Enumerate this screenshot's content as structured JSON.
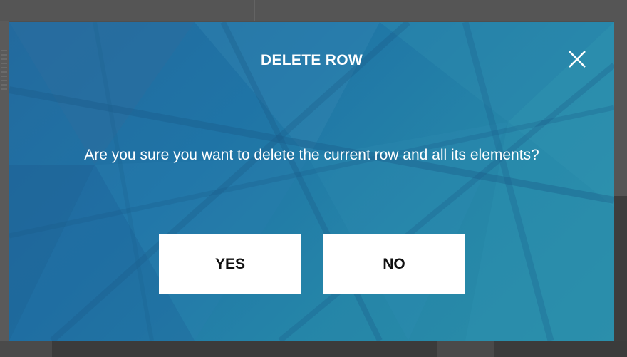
{
  "dialog": {
    "title": "DELETE ROW",
    "message": "Are you sure you want to delete the current row and all its elements?",
    "close_icon": "close-icon",
    "buttons": {
      "yes_label": "YES",
      "no_label": "NO"
    }
  },
  "colors": {
    "modal_primary": "#1f74a6",
    "modal_secondary": "#2a8ea8",
    "button_bg": "#ffffff",
    "button_text": "#111111",
    "text": "#ffffff",
    "overlay": "#4f4f4f"
  }
}
